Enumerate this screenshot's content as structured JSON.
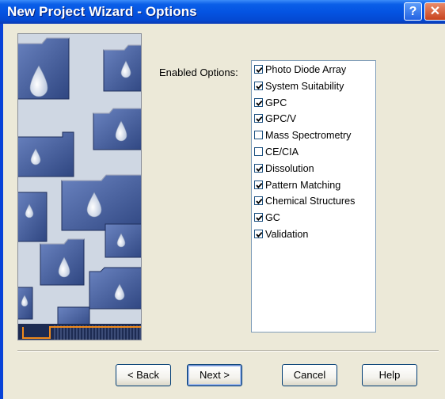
{
  "window": {
    "title": "New Project Wizard - Options",
    "help_glyph": "?",
    "close_glyph": "✕"
  },
  "options": {
    "label": "Enabled Options:",
    "items": [
      {
        "label": "Photo Diode Array",
        "checked": true
      },
      {
        "label": "System Suitability",
        "checked": true
      },
      {
        "label": "GPC",
        "checked": true
      },
      {
        "label": "GPC/V",
        "checked": true
      },
      {
        "label": "Mass Spectrometry",
        "checked": false
      },
      {
        "label": "CE/CIA",
        "checked": false
      },
      {
        "label": "Dissolution",
        "checked": true
      },
      {
        "label": "Pattern Matching",
        "checked": true
      },
      {
        "label": "Chemical Structures",
        "checked": true
      },
      {
        "label": "GC",
        "checked": true
      },
      {
        "label": "Validation",
        "checked": true
      }
    ]
  },
  "buttons": {
    "back": "< Back",
    "next": "Next >",
    "cancel": "Cancel",
    "help": "Help"
  },
  "colors": {
    "title_bar": "#0454e2",
    "dialog_face": "#ece9d8",
    "folder_blue": "#46609e",
    "accent_orange": "#f08a1c"
  }
}
